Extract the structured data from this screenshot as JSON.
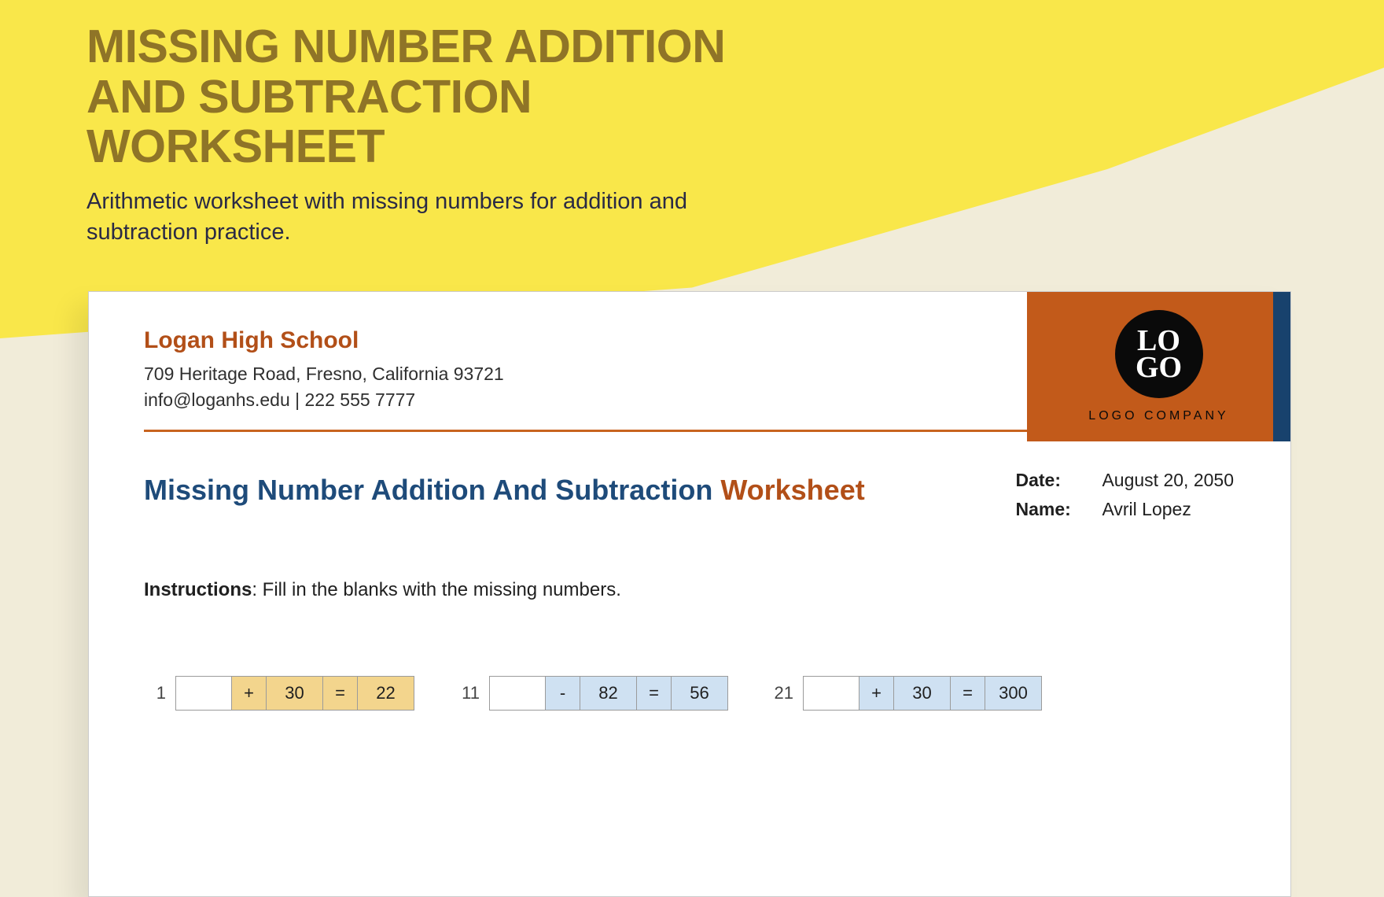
{
  "hero": {
    "title": "MISSING NUMBER ADDITION AND SUBTRACTION WORKSHEET",
    "subtitle": "Arithmetic worksheet with missing numbers for addition and subtraction practice."
  },
  "letterhead": {
    "school": "Logan High School",
    "address": "709 Heritage Road, Fresno, California 93721",
    "contact": "info@loganhs.edu | 222 555 7777",
    "logo_top": "LO",
    "logo_bottom": "GO",
    "logo_company": "LOGO COMPANY"
  },
  "worksheet": {
    "title_part1": "Missing Number Addition And Subtraction ",
    "title_part2": "Worksheet",
    "meta": {
      "date_label": "Date:",
      "date_value": "August 20, 2050",
      "name_label": "Name:",
      "name_value": "Avril Lopez"
    },
    "instructions_label": "Instructions",
    "instructions_text": ": Fill in the blanks with the missing numbers."
  },
  "problems": [
    {
      "num": "1",
      "blank": "",
      "op": "+",
      "b": "30",
      "eq": "=",
      "r": "22",
      "color": "yellow"
    },
    {
      "num": "11",
      "blank": "",
      "op": "-",
      "b": "82",
      "eq": "=",
      "r": "56",
      "color": "blue"
    },
    {
      "num": "21",
      "blank": "",
      "op": "+",
      "b": "30",
      "eq": "=",
      "r": "300",
      "color": "blue"
    }
  ]
}
